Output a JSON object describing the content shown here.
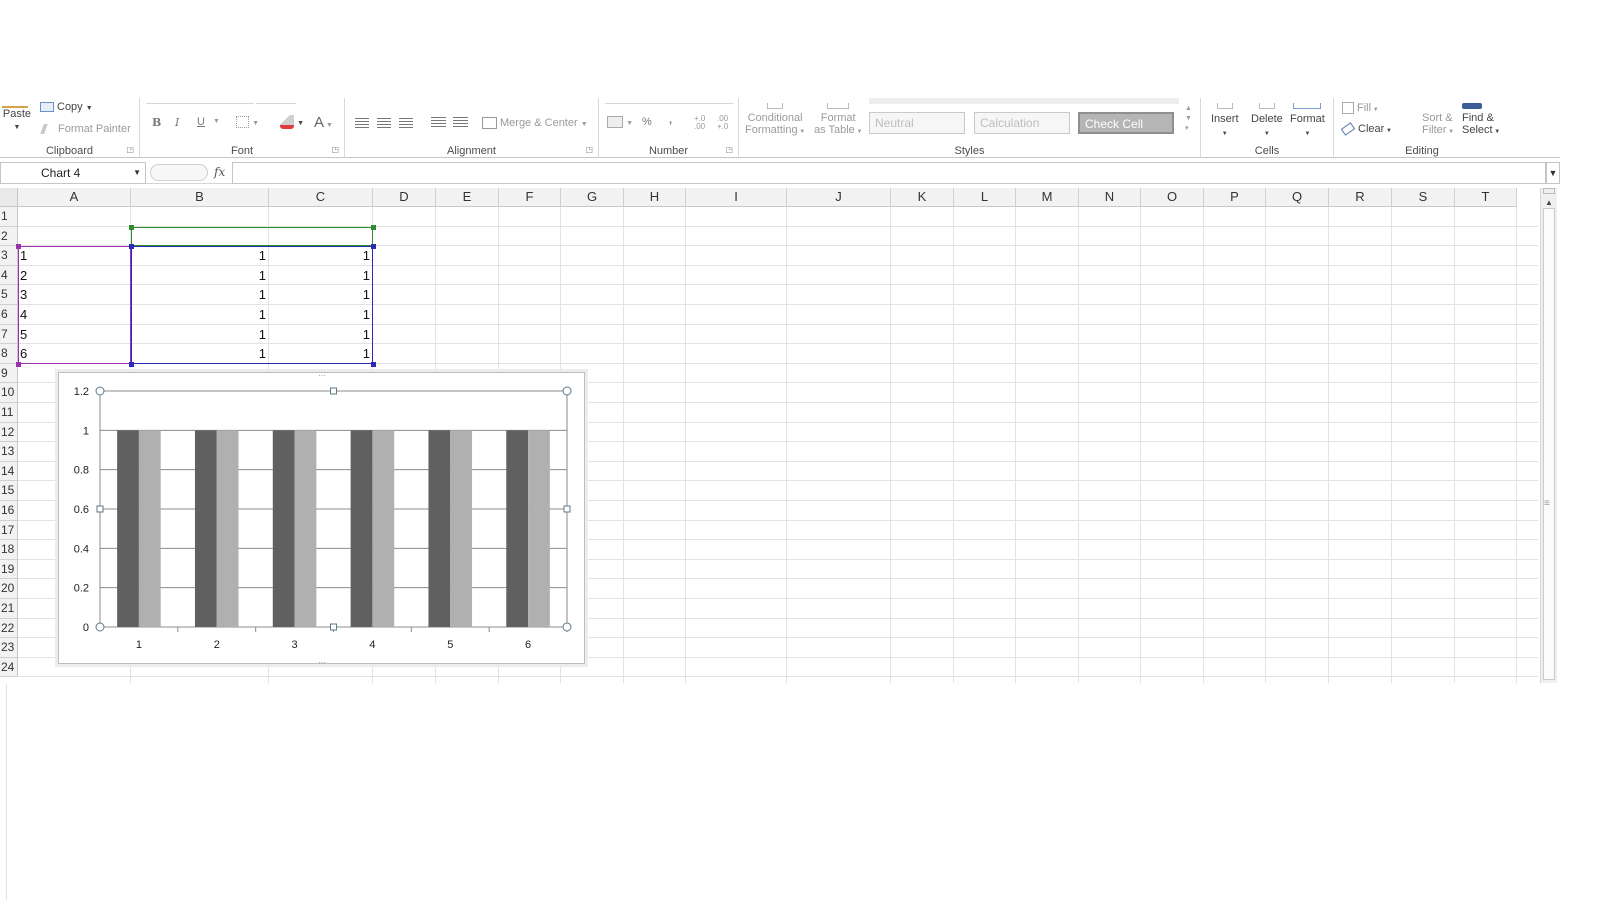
{
  "ribbon": {
    "clipboard": {
      "label": "Clipboard",
      "paste": "Paste",
      "copy": "Copy",
      "format_painter": "Format Painter"
    },
    "font": {
      "label": "Font",
      "bold": "B",
      "italic": "I",
      "underline": "U",
      "font_color": "A"
    },
    "alignment": {
      "label": "Alignment",
      "merge_center": "Merge & Center"
    },
    "number": {
      "label": "Number",
      "percent": "%",
      "comma": ",",
      "inc_decimal": "+.0 .00",
      "dec_decimal": ".00 +.0"
    },
    "styles": {
      "label": "Styles",
      "conditional_formatting": [
        "Conditional",
        "Formatting"
      ],
      "format_as_table": [
        "Format",
        "as Table"
      ],
      "cell_styles": [
        "Neutral",
        "Calculation",
        "Check Cell"
      ]
    },
    "cells": {
      "label": "Cells",
      "insert": "Insert",
      "delete": "Delete",
      "format": "Format"
    },
    "editing": {
      "label": "Editing",
      "fill": "Fill",
      "clear": "Clear",
      "sort_filter": [
        "Sort &",
        "Filter"
      ],
      "find_select": [
        "Find &",
        "Select"
      ]
    }
  },
  "formula_bar": {
    "name_box": "Chart 4",
    "fx": "fx",
    "formula": ""
  },
  "grid": {
    "columns": [
      "A",
      "B",
      "C",
      "D",
      "E",
      "F",
      "G",
      "H",
      "I",
      "J",
      "K",
      "L",
      "M",
      "N",
      "O",
      "P",
      "Q",
      "R",
      "S",
      "T"
    ],
    "rows": [
      "1",
      "2",
      "3",
      "4",
      "5",
      "6",
      "7",
      "8",
      "9",
      "10",
      "11",
      "12",
      "13",
      "14",
      "15",
      "16",
      "17",
      "18",
      "19",
      "20",
      "21",
      "22",
      "23",
      "24"
    ],
    "cells": [
      [
        "1",
        "1",
        "1"
      ],
      [
        "2",
        "1",
        "1"
      ],
      [
        "3",
        "1",
        "1"
      ],
      [
        "4",
        "1",
        "1"
      ],
      [
        "5",
        "1",
        "1"
      ],
      [
        "6",
        "1",
        "1"
      ]
    ]
  },
  "chart_data": {
    "type": "bar",
    "categories": [
      "1",
      "2",
      "3",
      "4",
      "5",
      "6"
    ],
    "series": [
      {
        "values": [
          1,
          1,
          1,
          1,
          1,
          1
        ],
        "color": "#606060"
      },
      {
        "values": [
          1,
          1,
          1,
          1,
          1,
          1
        ],
        "color": "#b0b0b0"
      }
    ],
    "yticks": [
      "0",
      "0.2",
      "0.4",
      "0.6",
      "0.8",
      "1",
      "1.2"
    ],
    "ylim": [
      0,
      1.2
    ],
    "grid": true,
    "legend": "none"
  },
  "colors": {
    "range_blue": "#2b2bb8",
    "range_green": "#2e8b2e",
    "range_purple": "#9b30b0"
  }
}
